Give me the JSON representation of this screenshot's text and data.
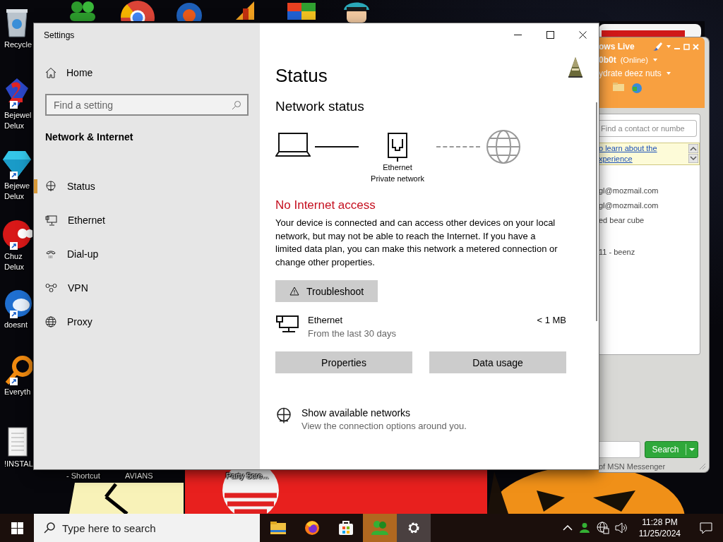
{
  "desktop": {
    "icons": [
      {
        "lines": [
          "Recycle"
        ],
        "shortcut": false
      },
      {
        "lines": [
          "Bejewel",
          "Delux"
        ],
        "shortcut": true
      },
      {
        "lines": [
          "Bejewe",
          "Delux"
        ],
        "shortcut": true
      },
      {
        "lines": [
          "Chuz",
          "Delux"
        ],
        "shortcut": true
      },
      {
        "lines": [
          "doesnt"
        ],
        "shortcut": true
      },
      {
        "lines": [
          "Everyth"
        ],
        "shortcut": true
      },
      {
        "lines": [
          "!INSTAL"
        ],
        "shortcut": false
      }
    ],
    "partly_hidden_icons": [
      {
        "label": "- Shortcut"
      },
      {
        "label": "AVIANS"
      },
      {
        "label": "Party Scre..."
      }
    ]
  },
  "settings": {
    "title": "Settings",
    "home": "Home",
    "search": {
      "placeholder": "Find a setting"
    },
    "section": "Network & Internet",
    "nav": [
      {
        "label": "Status",
        "selected": true
      },
      {
        "label": "Ethernet",
        "selected": false
      },
      {
        "label": "Dial-up",
        "selected": false
      },
      {
        "label": "VPN",
        "selected": false
      },
      {
        "label": "Proxy",
        "selected": false
      }
    ],
    "page_title": "Status",
    "subtitle": "Network status",
    "diagram": {
      "adapter": "Ethernet",
      "profile": "Private network",
      "internet_connected": false
    },
    "alert": "No Internet access",
    "description": "Your device is connected and can access other devices on your local network, but may not be able to reach the Internet. If you have a limited data plan, you can make this network a metered connection or change other properties.",
    "troubleshoot": "Troubleshoot",
    "usage": {
      "name": "Ethernet",
      "period": "From the last 30 days",
      "amount": "< 1 MB"
    },
    "buttons": [
      "Properties",
      "Data usage"
    ],
    "networks_link": {
      "title": "Show available networks",
      "subtitle": "View the connection options around you."
    }
  },
  "messenger": {
    "header_title": "ows Live",
    "user": "0b0t",
    "status": "(Online)",
    "personal_message": "ydrate deez nuts",
    "search": {
      "placeholder": "Find a contact or numbe"
    },
    "banner_link_lines": [
      "o learn about the",
      "xperience"
    ],
    "groups": [
      {
        "contacts": [
          "gl@mozmail.com",
          "gl@mozmail.com",
          "ed bear cube"
        ]
      },
      {
        "contacts": [
          "11 - beenz"
        ]
      }
    ],
    "search_button": "Search",
    "footer": "of MSN Messenger"
  },
  "taskbar": {
    "search": {
      "placeholder": "Type here to search"
    },
    "apps": [
      {
        "selected": false,
        "flashing": false
      },
      {
        "selected": false,
        "flashing": false
      },
      {
        "selected": false,
        "flashing": false
      },
      {
        "selected": false,
        "flashing": true
      },
      {
        "selected": true,
        "flashing": false
      }
    ],
    "time": "11:28 PM",
    "date": "11/25/2024"
  }
}
